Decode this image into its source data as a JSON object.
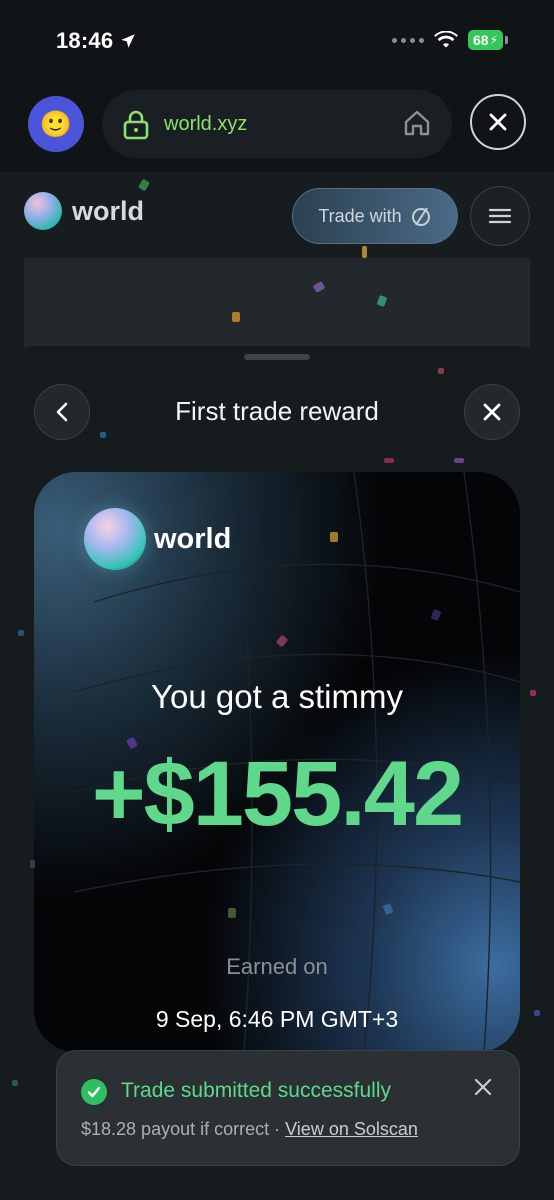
{
  "status_bar": {
    "time": "18:46",
    "battery": "68"
  },
  "browser": {
    "avatar_emoji": "🙂",
    "url": "world.xyz"
  },
  "site": {
    "logo_text": "world",
    "trade_button": "Trade with"
  },
  "sheet": {
    "title": "First trade reward"
  },
  "card": {
    "logo_text": "world",
    "headline": "You got a stimmy",
    "amount": "+$155.42",
    "earned_label": "Earned on",
    "earned_date": "9 Sep, 6:46 PM GMT+3"
  },
  "toast": {
    "title": "Trade submitted successfully",
    "subtitle": "$18.28 payout if correct ·",
    "link": "View on Solscan"
  },
  "colors": {
    "accent_green": "#5fd88c",
    "url_green": "#8ee06f",
    "success_green": "#2fbf63",
    "avatar_blue": "#4a55d9"
  }
}
